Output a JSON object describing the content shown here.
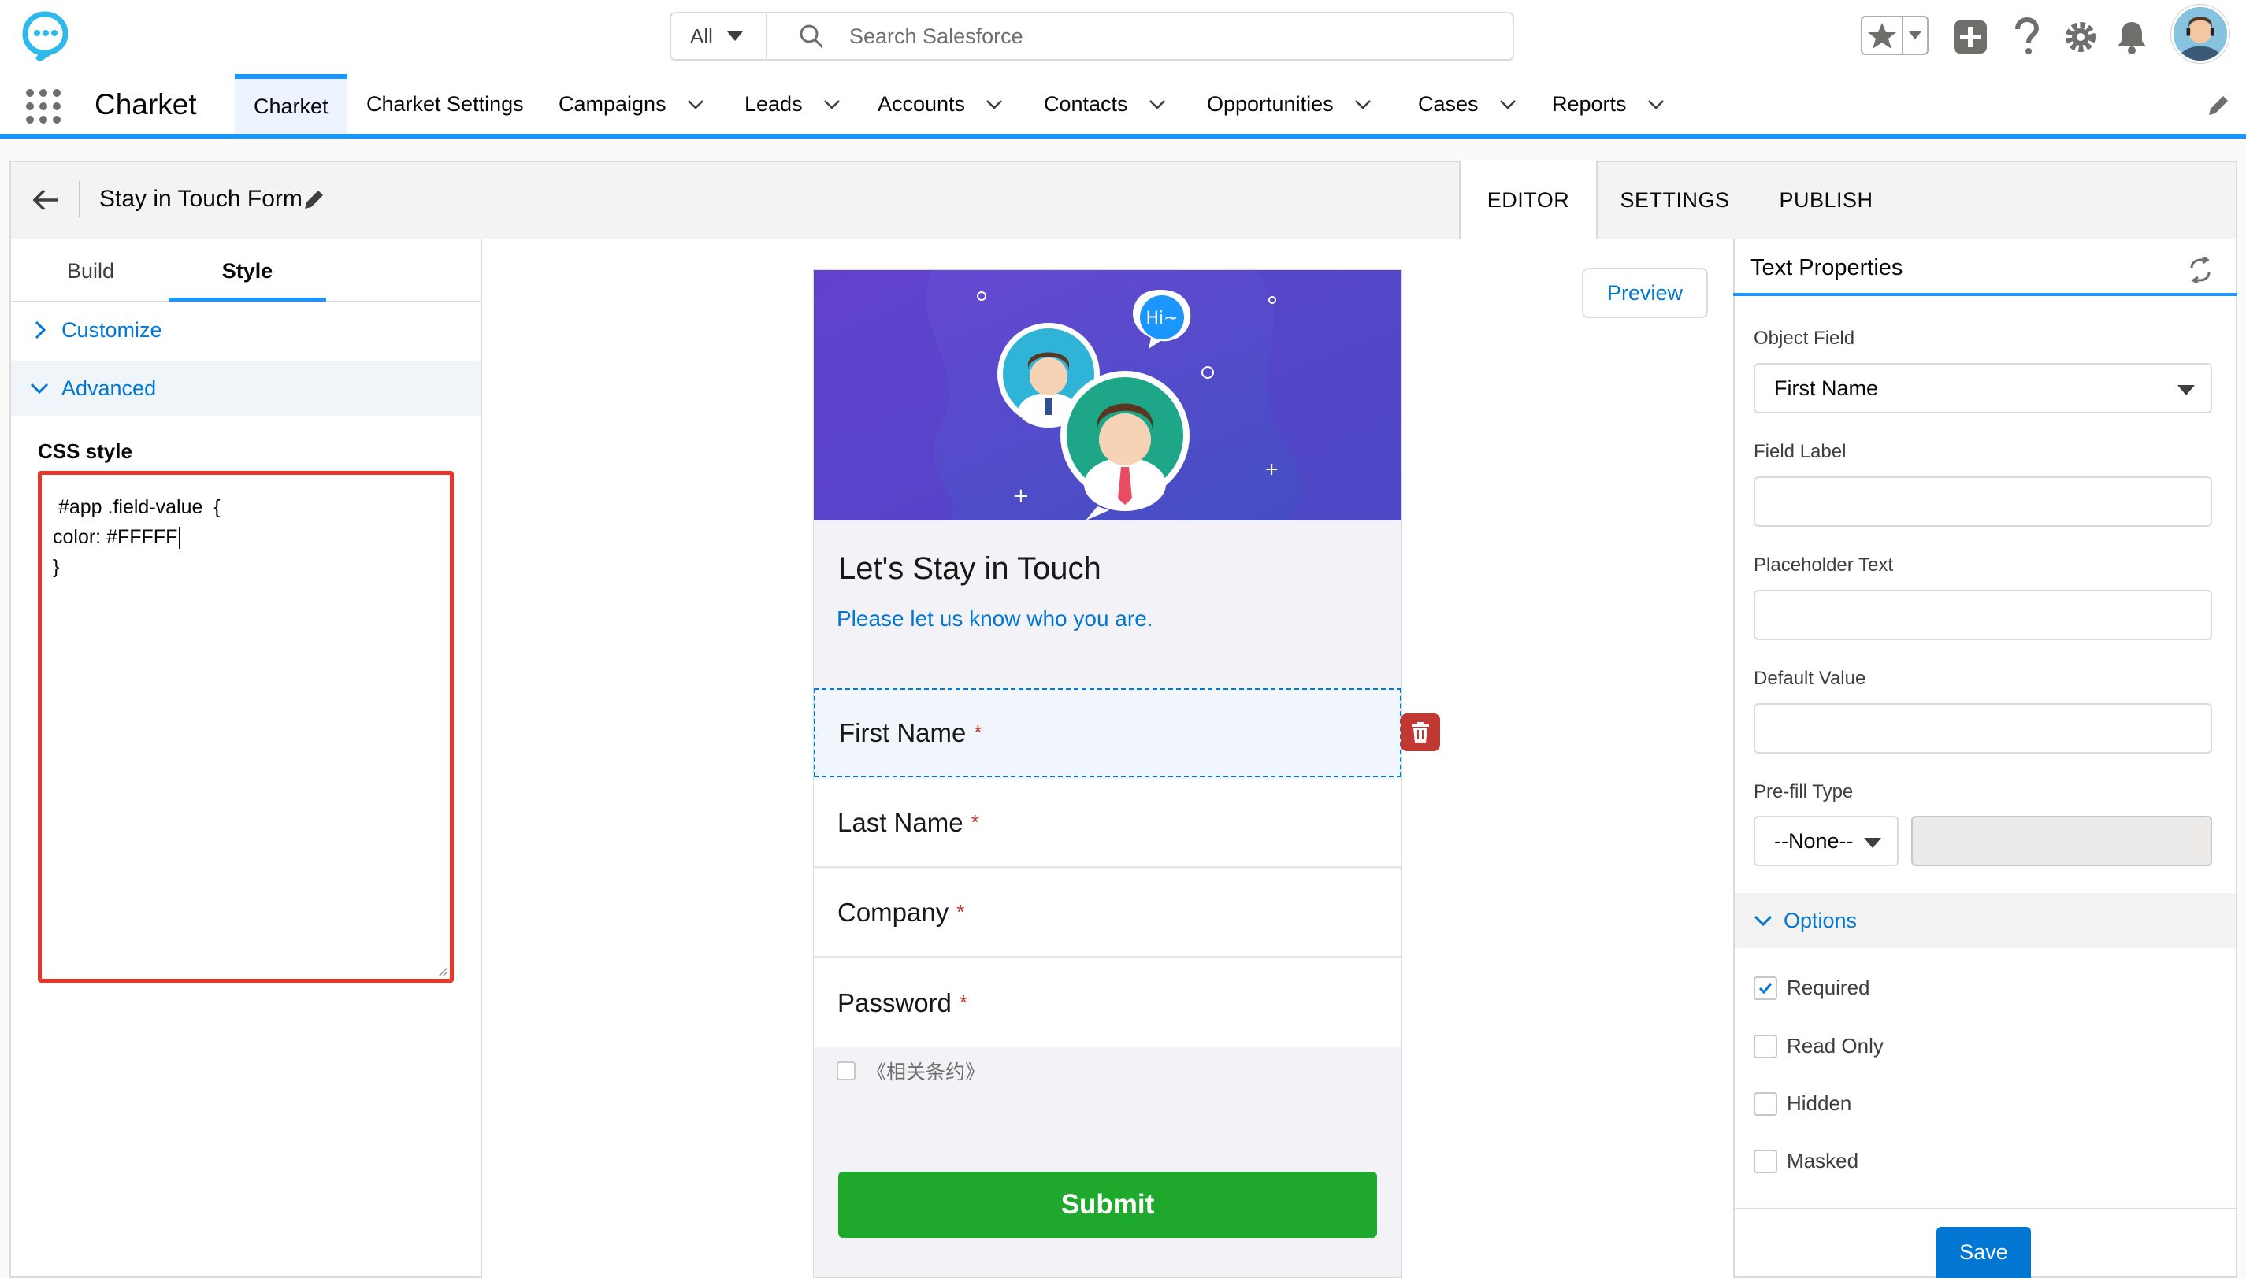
{
  "header": {
    "search_scope": "All",
    "search_placeholder": "Search Salesforce"
  },
  "nav": {
    "app_name": "Charket",
    "tabs": [
      {
        "label": "Charket",
        "has_menu": false,
        "active": true
      },
      {
        "label": "Charket Settings",
        "has_menu": false
      },
      {
        "label": "Campaigns",
        "has_menu": true
      },
      {
        "label": "Leads",
        "has_menu": true
      },
      {
        "label": "Accounts",
        "has_menu": true
      },
      {
        "label": "Contacts",
        "has_menu": true
      },
      {
        "label": "Opportunities",
        "has_menu": true
      },
      {
        "label": "Cases",
        "has_menu": true
      },
      {
        "label": "Reports",
        "has_menu": true
      }
    ]
  },
  "toolbar": {
    "form_title": "Stay in Touch Form",
    "tabs": {
      "editor": "EDITOR",
      "settings": "SETTINGS",
      "publish": "PUBLISH"
    }
  },
  "left_panel": {
    "tabs": {
      "build": "Build",
      "style": "Style"
    },
    "customize_label": "Customize",
    "advanced_label": "Advanced",
    "css_label": "CSS style",
    "css_lines": [
      " #app .field-value  {",
      "color: #FFFFF",
      "}"
    ]
  },
  "center": {
    "preview_label": "Preview",
    "banner_bubble": "Hi~",
    "form_title": "Let's Stay in Touch",
    "form_subtitle": "Please let us know who you are.",
    "fields": [
      {
        "label": "First Name",
        "required": "*"
      },
      {
        "label": "Last Name",
        "required": "*"
      },
      {
        "label": "Company",
        "required": "*"
      },
      {
        "label": "Password",
        "required": "*"
      }
    ],
    "terms_label": "《相关条约》",
    "submit_label": "Submit"
  },
  "right_panel": {
    "title": "Text Properties",
    "object_field_label": "Object Field",
    "object_field_value": "First Name",
    "field_label_label": "Field Label",
    "field_label_value": "",
    "placeholder_label": "Placeholder Text",
    "placeholder_value": "",
    "default_value_label": "Default Value",
    "default_value_value": "",
    "prefill_label": "Pre-fill Type",
    "prefill_value": "--None--",
    "options_label": "Options",
    "options": [
      {
        "label": "Required",
        "checked": true
      },
      {
        "label": "Read Only",
        "checked": false
      },
      {
        "label": "Hidden",
        "checked": false
      },
      {
        "label": "Masked",
        "checked": false
      }
    ],
    "save_label": "Save"
  },
  "colors": {
    "brand_blue": "#0176d3",
    "accent_blue": "#1b96ff",
    "submit_green": "#1ea92d",
    "danger_red": "#c23934",
    "highlight_red": "#e8362b",
    "banner_purple": "#5b3fc4"
  }
}
